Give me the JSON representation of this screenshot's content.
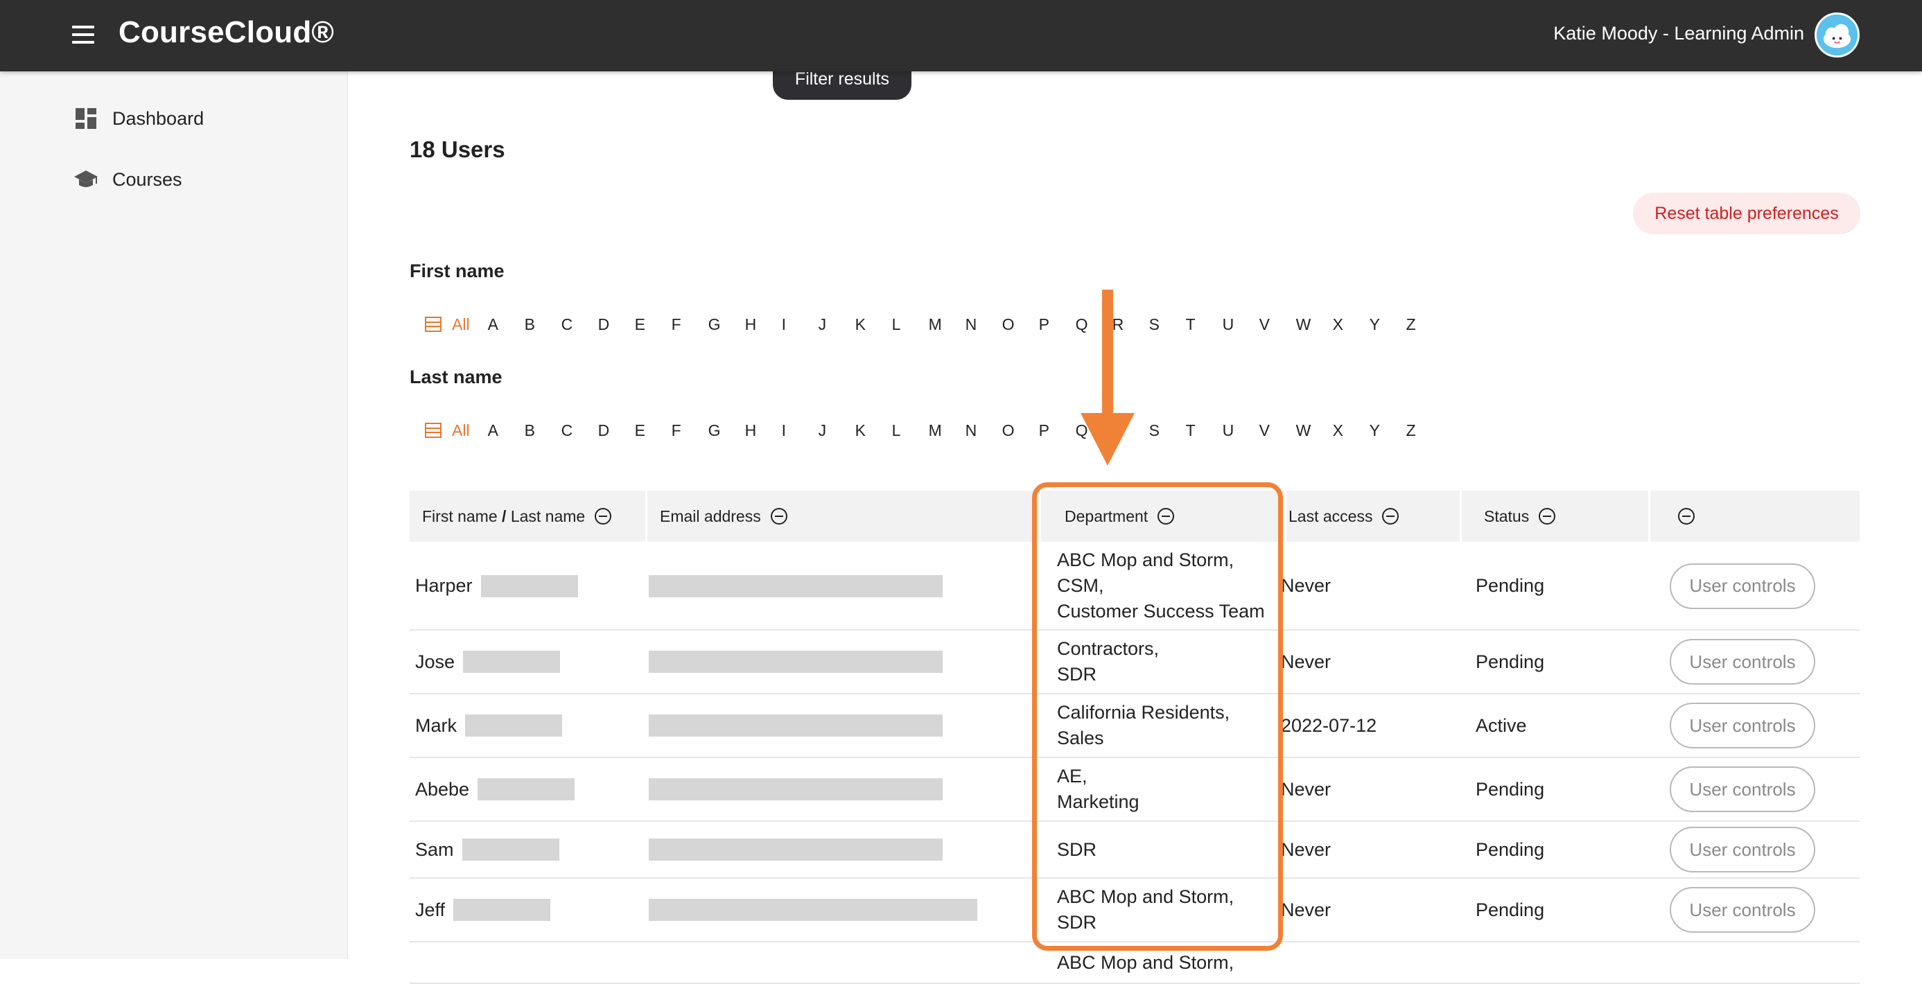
{
  "header": {
    "app_name": "CourseCloud®",
    "user_label": "Katie Moody - Learning Admin"
  },
  "sidebar": {
    "items": [
      {
        "label": "Dashboard",
        "icon": "dashboard-icon"
      },
      {
        "label": "Courses",
        "icon": "graduation-cap-icon"
      }
    ]
  },
  "main": {
    "filter_button": "Filter results",
    "users_count": "18 Users",
    "reset_button": "Reset table preferences",
    "first_name_label": "First name",
    "last_name_label": "Last name",
    "all_label": "All",
    "letters": [
      "A",
      "B",
      "C",
      "D",
      "E",
      "F",
      "G",
      "H",
      "I",
      "J",
      "K",
      "L",
      "M",
      "N",
      "O",
      "P",
      "Q",
      "R",
      "S",
      "T",
      "U",
      "V",
      "W",
      "X",
      "Y",
      "Z"
    ]
  },
  "table": {
    "columns": [
      {
        "label_first": "First name",
        "label_sep": " / ",
        "label_last": "Last name"
      },
      {
        "label": "Email address"
      },
      {
        "label": "Department"
      },
      {
        "label": "Last access"
      },
      {
        "label": "Status"
      },
      {
        "label": ""
      }
    ],
    "rows": [
      {
        "first_name": "Harper",
        "department": [
          "ABC Mop and Storm,",
          "CSM,",
          "Customer Success Team"
        ],
        "last_access": "Never",
        "status": "Pending",
        "action": "User controls"
      },
      {
        "first_name": "Jose",
        "department": [
          "Contractors,",
          "SDR"
        ],
        "last_access": "Never",
        "status": "Pending",
        "action": "User controls"
      },
      {
        "first_name": "Mark",
        "department": [
          "California Residents,",
          "Sales"
        ],
        "last_access": "2022-07-12",
        "status": "Active",
        "action": "User controls"
      },
      {
        "first_name": "Abebe",
        "department": [
          "AE,",
          "Marketing"
        ],
        "last_access": "Never",
        "status": "Pending",
        "action": "User controls"
      },
      {
        "first_name": "Sam",
        "department": [
          "SDR"
        ],
        "last_access": "Never",
        "status": "Pending",
        "action": "User controls"
      },
      {
        "first_name": "Jeff",
        "department": [
          "ABC Mop and Storm,",
          "SDR"
        ],
        "last_access": "Never",
        "status": "Pending",
        "action": "User controls"
      },
      {
        "first_name": "",
        "department": [
          "ABC Mop and Storm,"
        ],
        "last_access": "",
        "status": "",
        "action": ""
      }
    ]
  },
  "colors": {
    "topbar": "#2f2f2f",
    "accent_orange": "#f08237",
    "reset_red": "#d21f1f"
  }
}
